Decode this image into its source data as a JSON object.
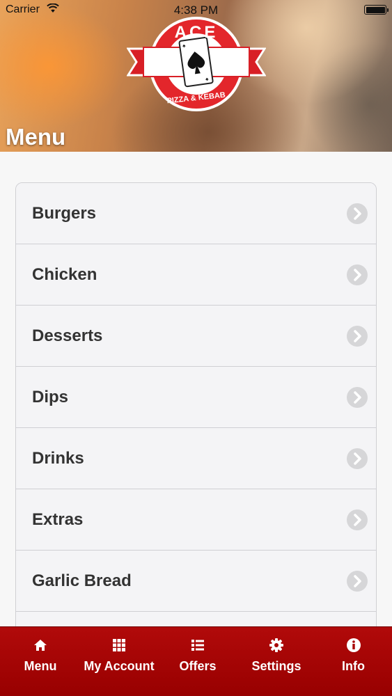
{
  "status_bar": {
    "carrier": "Carrier",
    "time": "4:38 PM",
    "battery_level": 1.0
  },
  "header": {
    "logo": {
      "brand": "ACE",
      "tagline": "PIZZA & KEBAB"
    },
    "title": "Menu"
  },
  "menu": {
    "items": [
      {
        "label": "Burgers"
      },
      {
        "label": "Chicken"
      },
      {
        "label": "Desserts"
      },
      {
        "label": "Dips"
      },
      {
        "label": "Drinks"
      },
      {
        "label": "Extras"
      },
      {
        "label": "Garlic Bread"
      },
      {
        "label": ""
      }
    ],
    "chevron_icon": "chevron-right-circle-icon"
  },
  "tab_bar": {
    "tabs": [
      {
        "label": "Menu",
        "icon": "home-icon"
      },
      {
        "label": "My Account",
        "icon": "grid-icon"
      },
      {
        "label": "Offers",
        "icon": "list-icon"
      },
      {
        "label": "Settings",
        "icon": "gear-icon"
      },
      {
        "label": "Info",
        "icon": "info-icon"
      }
    ]
  },
  "colors": {
    "tab_bar": "#a80404",
    "logo_red": "#e3262b",
    "text_dark": "#333333"
  }
}
